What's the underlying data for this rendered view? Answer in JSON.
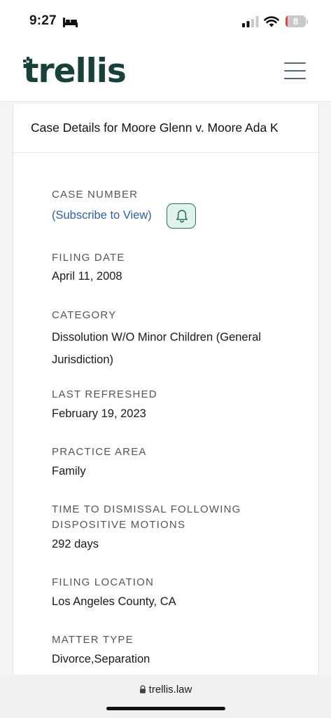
{
  "status_bar": {
    "time": "9:27",
    "battery_level": "8"
  },
  "header": {
    "logo_text": "trellis"
  },
  "case": {
    "title": "Case Details for Moore Glenn v. Moore Ada K",
    "fields": [
      {
        "label": "CASE NUMBER",
        "link": "(Subscribe to View)"
      },
      {
        "label": "FILING DATE",
        "value": "April 11, 2008"
      },
      {
        "label": "CATEGORY",
        "value": "Dissolution W/O Minor Children (General Jurisdiction)"
      },
      {
        "label": "LAST REFRESHED",
        "value": "February 19, 2023"
      },
      {
        "label": "PRACTICE AREA",
        "value": "Family"
      },
      {
        "label": "TIME TO DISMISSAL FOLLOWING DISPOSITIVE MOTIONS",
        "value": "292 days"
      },
      {
        "label": "FILING LOCATION",
        "value": "Los Angeles County, CA"
      },
      {
        "label": "MATTER TYPE",
        "value": "Divorce,Separation"
      }
    ]
  },
  "browser": {
    "url": "trellis.law"
  },
  "colors": {
    "brand": "#17413a",
    "link": "#2b5fbd",
    "bell_bg": "#dff2ec",
    "battery_low": "#e5483c"
  }
}
